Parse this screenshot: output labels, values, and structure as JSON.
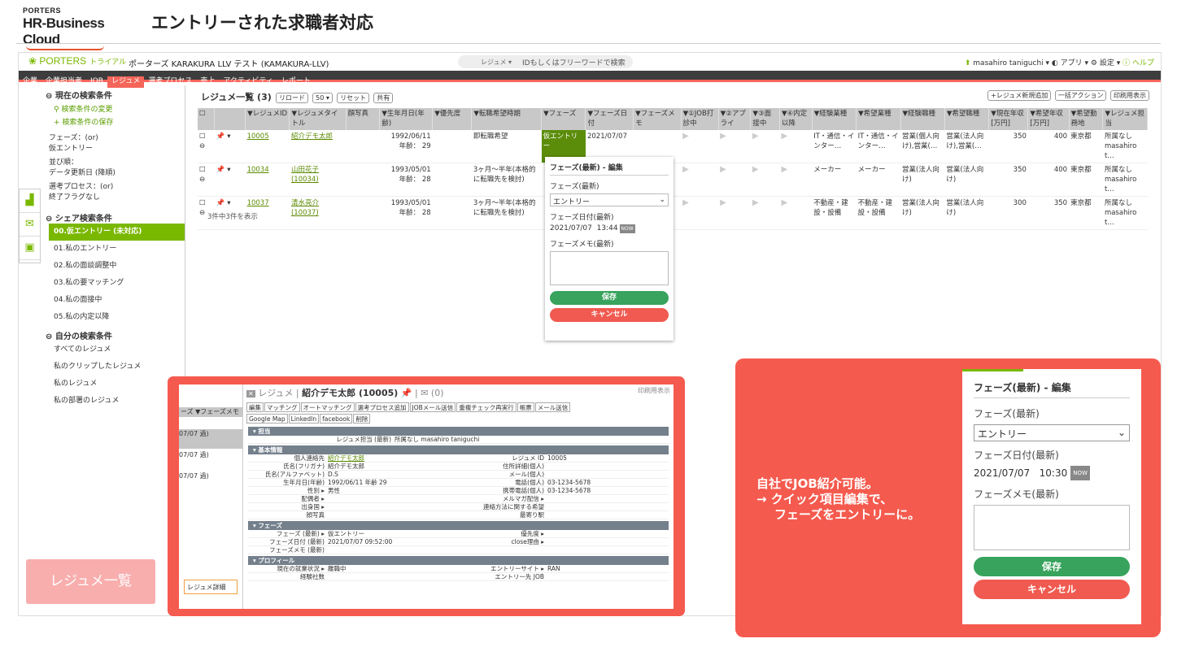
{
  "header": {
    "logo_small": "PORTERS",
    "logo_big": "HR-Business Cloud",
    "title": "エントリーされた求職者対応"
  },
  "app": {
    "brand": "PORTERS",
    "brand_sub": "トライアル",
    "tenant": "ポーターズ KARAKURA LLV テスト (KAMAKURA-LLV)",
    "search_type": "レジュメ",
    "search_placeholder": "IDもしくはフリーワードで検索",
    "user": "masahiro taniguchi ▾",
    "apps": "アプリ ▾",
    "settings": "設定 ▾",
    "help": "ヘルプ",
    "menu": [
      "企業",
      "企業担当者",
      "JOB",
      "レジュメ",
      "選考プロセス",
      "売上",
      "アクティビティ",
      "レポート"
    ]
  },
  "left": {
    "current_title": "現在の検索条件",
    "change": "検索条件の変更",
    "save": "検索条件の保存",
    "cond1": "フェーズ：(or)",
    "cond1v": "仮エントリー",
    "sort": "並び順：",
    "sortv": "データ更新日 (降順)",
    "cond2": "選考プロセス：(or)",
    "cond2v": "終了フラグなし",
    "share_title": "シェア検索条件",
    "share": [
      "00.仮エントリー (未対応)",
      "01.私のエントリー",
      "02.私の面談調整中",
      "03.私の要マッチング",
      "04.私の面接中",
      "05.私の内定以降"
    ],
    "own_title": "自分の検索条件",
    "own": [
      "すべてのレジュメ",
      "私のクリップしたレジュメ",
      "私のレジュメ",
      "私の部署のレジュメ"
    ]
  },
  "list": {
    "title": "レジュメ一覧 (3)",
    "reload": "リロード",
    "per_page": "50 ▾",
    "reset": "リセット",
    "share": "共有",
    "new": "+レジュメ新規追加",
    "bulk": "一括アクション",
    "print": "印刷用表示",
    "columns": [
      "▼レジュメID",
      "▼レジュメタイトル",
      "顔写真",
      "▼生年月日(年齢)",
      "▼優先度",
      "▼転職希望時期",
      "▼フェーズ",
      "▼フェーズ日付",
      "▼フェーズメモ",
      "▼①JOB打診中",
      "▼②アプライ",
      "▼③面接中",
      "▼④内定以降",
      "▼経験業種",
      "▼希望業種",
      "▼経験職種",
      "▼希望職種",
      "▼現在年収[万円]",
      "▼希望年収[万円]",
      "▼希望勤務地",
      "▼レジュメ担当"
    ],
    "rows": [
      {
        "id": "10005",
        "name": "紹介デモ太郎",
        "dob": "1992/06/11",
        "age": "年齢： 29",
        "timing": "即転職希望",
        "phase": "仮エントリー",
        "pdate": "2021/07/07",
        "exp_ind": "IT・通信・インター…",
        "want_ind": "IT・通信・インター…",
        "exp_job": "営業(個人向け),営業(…",
        "want_job": "営業(法人向け),営業(…",
        "cur": "350",
        "want": "400",
        "loc": "東京都",
        "owner": "所属なし masahiro t…"
      },
      {
        "id": "10034",
        "name": "山田花子(10034)",
        "dob": "1993/05/01",
        "age": "年齢： 28",
        "timing": "3ヶ月〜半年(本格的に転職先を検討)",
        "phase": "",
        "pdate": "",
        "exp_ind": "メーカー",
        "want_ind": "メーカー",
        "exp_job": "営業(法人向け)",
        "want_job": "営業(法人向け)",
        "cur": "350",
        "want": "400",
        "loc": "東京都",
        "owner": "所属なし masahiro t…"
      },
      {
        "id": "10037",
        "name": "清水亮介(10037)",
        "dob": "1993/05/01",
        "age": "年齢： 28",
        "timing": "3ヶ月〜半年(本格的に転職先を検討)",
        "phase": "",
        "pdate": "",
        "exp_ind": "不動産・建設・設備",
        "want_ind": "不動産・建設・設備",
        "exp_job": "営業(法人向け)",
        "want_job": "営業(法人向け)",
        "cur": "300",
        "want": "350",
        "loc": "東京都",
        "owner": "所属なし masahiro t…"
      }
    ],
    "footer": "3件中3件を表示"
  },
  "popup": {
    "title": "フェーズ(最新) - 編集",
    "phase_label": "フェーズ(最新)",
    "phase_value": "エントリー",
    "date_label": "フェーズ日付(最新)",
    "date": "2021/07/07",
    "time": "13:44",
    "now": "NOW",
    "memo_label": "フェーズメモ(最新)",
    "save": "保存",
    "cancel": "キャンセル"
  },
  "detail": {
    "title_prefix": "レジュメ",
    "title_name": "紹介デモ太郎 (10005)",
    "mail_count": "(0)",
    "print": "印刷用表示",
    "buttons": [
      "編集",
      "マッチング",
      "オートマッチング",
      "選考プロセス追加",
      "JOBメール送信",
      "重複チェック再実行",
      "帳票",
      "メール送信",
      "Google Map",
      "LinkedIn",
      "facebook",
      "削除"
    ],
    "bg_header": "ーズ ▼フェーズメモ",
    "bg_rows": [
      "07/07\n過)",
      "07/07\n過)",
      "07/07\n過)"
    ],
    "sec1": "担当",
    "owner_k": "レジュメ担当 (最新)",
    "owner_v": "所属なし masahiro taniguchi",
    "sec2": "基本情報",
    "basic": [
      [
        "個人連絡先",
        "紹介デモ太郎",
        "レジュメ ID",
        "10005"
      ],
      [
        "氏名(フリガナ)",
        "紹介デモ太郎",
        "住所詳細(個人)",
        ""
      ],
      [
        "氏名(アルファベット)",
        "D.S",
        "メール(個人)",
        ""
      ],
      [
        "生年月日(年齢)",
        "1992/06/11 年齢 29",
        "電話(個人)",
        "03-1234-5678"
      ],
      [
        "性別 ▸",
        "男性",
        "携帯電話(個人)",
        "03-1234-5678"
      ],
      [
        "配偶者 ▸",
        "",
        "メルマガ配信 ▸",
        ""
      ],
      [
        "出身国 ▸",
        "",
        "連絡方法に関する希望",
        ""
      ],
      [
        "顔写真",
        "",
        "最寄り駅",
        ""
      ]
    ],
    "sec3": "フェーズ",
    "phase": [
      [
        "フェーズ (最新) ▸",
        "仮エントリー",
        "優先度 ▸",
        ""
      ],
      [
        "フェーズ日付 (最新)",
        "2021/07/07 09:52:00",
        "close理由 ▸",
        ""
      ],
      [
        "フェーズメモ (最新)",
        "",
        "",
        ""
      ]
    ],
    "sec4": "プロフィール",
    "profile": [
      [
        "現在の就業状況 ▸",
        "離職中",
        "エントリーサイト ▸",
        "RAN"
      ],
      [
        "経験社数",
        "",
        "エントリー先 JOB",
        ""
      ]
    ],
    "sidetab": "レジュメ詳細"
  },
  "badge": "レジュメ一覧",
  "callout": {
    "line1": "自社でJOB紹介可能。",
    "line2": "→ クイック項目編集で、",
    "line3": "フェーズをエントリーに。"
  },
  "zoom": {
    "title": "フェーズ(最新) - 編集",
    "phase_label": "フェーズ(最新)",
    "phase_value": "エントリー",
    "date_label": "フェーズ日付(最新)",
    "date": "2021/07/07",
    "time": "10:30",
    "now": "NOW",
    "memo_label": "フェーズメモ(最新)",
    "save": "保存",
    "cancel": "キャンセル"
  },
  "colors": {
    "accent": "#f55a4e",
    "green": "#7ab800",
    "save": "#37a35c",
    "cancel": "#f05a50"
  }
}
